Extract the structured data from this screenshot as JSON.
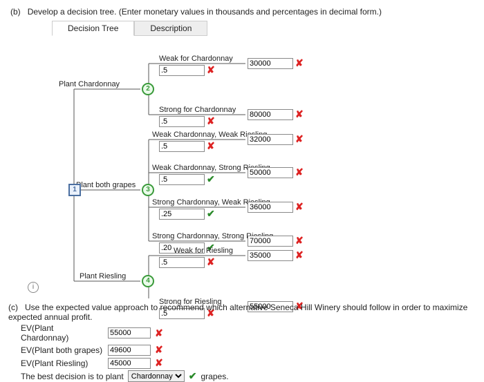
{
  "partB": {
    "label": "(b)",
    "prompt": "Develop a decision tree. (Enter monetary values in thousands and percentages in decimal form.)"
  },
  "tabs": {
    "tree": "Decision Tree",
    "desc": "Description"
  },
  "labels": {
    "plant_chardonnay": "Plant Chardonnay",
    "plant_both": "Plant both grapes",
    "plant_riesling": "Plant Riesling",
    "weak_chard": "Weak for Chardonnay",
    "strong_chard": "Strong for Chardonnay",
    "wc_wr": "Weak Chardonnay, Weak Riesling",
    "wc_sr": "Weak Chardonnay, Strong Riesling",
    "sc_wr": "Strong Chardonnay, Weak Riesling",
    "sc_sr": "Strong Chardonnay, Strong Riesling",
    "weak_ries": "Weak for Riesling",
    "strong_ries": "Strong for Riesling"
  },
  "probs": {
    "weak_chard": ".5",
    "strong_chard": ".5",
    "wc_wr": ".5",
    "wc_sr": ".5",
    "sc_wr": ".25",
    "sc_sr": ".20",
    "weak_ries": ".5",
    "strong_ries": ".5"
  },
  "prob_marks": {
    "weak_chard": false,
    "strong_chard": false,
    "wc_wr": false,
    "wc_sr": true,
    "sc_wr": true,
    "sc_sr": true,
    "weak_ries": false,
    "strong_ries": false
  },
  "payoffs": {
    "weak_chard": "30000",
    "strong_chard": "80000",
    "wc_wr": "32000",
    "wc_sr": "50000",
    "sc_wr": "36000",
    "sc_sr": "70000",
    "weak_ries": "35000",
    "strong_ries": "55000"
  },
  "payoff_marks": {
    "weak_chard": false,
    "strong_chard": false,
    "wc_wr": false,
    "wc_sr": false,
    "sc_wr": false,
    "sc_sr": false,
    "weak_ries": false,
    "strong_ries": false
  },
  "nodes": {
    "root": "1",
    "n2": "2",
    "n3": "3",
    "n4": "4"
  },
  "partC": {
    "label": "(c)",
    "prompt": "Use the expected value approach to recommend which alternative Seneca Hill Winery should follow in order to maximize expected annual profit.",
    "ev_chard_label": "EV(Plant Chardonnay)",
    "ev_both_label": "EV(Plant both grapes)",
    "ev_ries_label": "EV(Plant Riesling)",
    "ev_chard": "55000",
    "ev_both": "49600",
    "ev_ries": "45000",
    "ev_marks": {
      "chard": false,
      "both": false,
      "ries": false
    },
    "sentence_a": "The best decision is to plant",
    "select": "Chardonnay",
    "select_mark": true,
    "sentence_b": "grapes."
  },
  "glyphs": {
    "ok": "✔",
    "bad": "✘"
  }
}
